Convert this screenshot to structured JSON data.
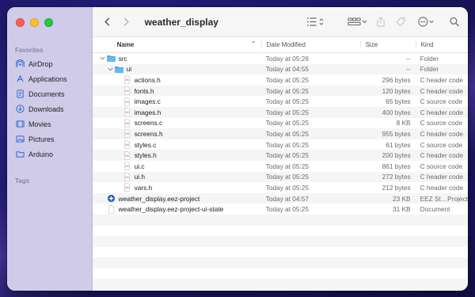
{
  "window": {
    "title": "weather_display"
  },
  "sidebar": {
    "favorites_label": "Favorites",
    "tags_label": "Tags",
    "items": [
      {
        "label": "AirDrop",
        "icon": "airdrop-icon"
      },
      {
        "label": "Applications",
        "icon": "applications-icon"
      },
      {
        "label": "Documents",
        "icon": "documents-icon"
      },
      {
        "label": "Downloads",
        "icon": "downloads-icon"
      },
      {
        "label": "Movies",
        "icon": "movies-icon"
      },
      {
        "label": "Pictures",
        "icon": "pictures-icon"
      },
      {
        "label": "Arduino",
        "icon": "folder-icon"
      }
    ]
  },
  "columns": {
    "name": "Name",
    "date": "Date Modified",
    "size": "Size",
    "kind": "Kind"
  },
  "rows": [
    {
      "name": "src",
      "date": "Today at 05:26",
      "size": "--",
      "kind": "Folder",
      "type": "folder",
      "level": 0,
      "expanded": true
    },
    {
      "name": "ui",
      "date": "Today at 04:55",
      "size": "--",
      "kind": "Folder",
      "type": "folder",
      "level": 1,
      "expanded": true
    },
    {
      "name": "actions.h",
      "date": "Today at 05:25",
      "size": "296 bytes",
      "kind": "C header code",
      "type": "file",
      "level": 2
    },
    {
      "name": "fonts.h",
      "date": "Today at 05:25",
      "size": "120 bytes",
      "kind": "C header code",
      "type": "file",
      "level": 2
    },
    {
      "name": "images.c",
      "date": "Today at 05:25",
      "size": "65 bytes",
      "kind": "C source code",
      "type": "file",
      "level": 2
    },
    {
      "name": "images.h",
      "date": "Today at 05:25",
      "size": "400 bytes",
      "kind": "C header code",
      "type": "file",
      "level": 2
    },
    {
      "name": "screens.c",
      "date": "Today at 05:25",
      "size": "8 KB",
      "kind": "C source code",
      "type": "file",
      "level": 2
    },
    {
      "name": "screens.h",
      "date": "Today at 05:25",
      "size": "955 bytes",
      "kind": "C header code",
      "type": "file",
      "level": 2
    },
    {
      "name": "styles.c",
      "date": "Today at 05:25",
      "size": "61 bytes",
      "kind": "C source code",
      "type": "file",
      "level": 2
    },
    {
      "name": "styles.h",
      "date": "Today at 05:25",
      "size": "200 bytes",
      "kind": "C header code",
      "type": "file",
      "level": 2
    },
    {
      "name": "ui.c",
      "date": "Today at 05:25",
      "size": "861 bytes",
      "kind": "C source code",
      "type": "file",
      "level": 2
    },
    {
      "name": "ui.h",
      "date": "Today at 05:25",
      "size": "272 bytes",
      "kind": "C header code",
      "type": "file",
      "level": 2
    },
    {
      "name": "vars.h",
      "date": "Today at 05:25",
      "size": "212 bytes",
      "kind": "C header code",
      "type": "file",
      "level": 2
    },
    {
      "name": "weather_display.eez-project",
      "date": "Today at 04:57",
      "size": "23 KB",
      "kind": "EEZ St…Project",
      "type": "eez",
      "level": 0
    },
    {
      "name": "weather_display.eez-project-ui-state",
      "date": "Today at 05:25",
      "size": "31 KB",
      "kind": "Document",
      "type": "doc",
      "level": 0
    },
    {
      "name": "",
      "date": "",
      "size": "",
      "kind": "",
      "type": "empty",
      "level": 0
    },
    {
      "name": "",
      "date": "",
      "size": "",
      "kind": "",
      "type": "empty",
      "level": 0
    },
    {
      "name": "",
      "date": "",
      "size": "",
      "kind": "",
      "type": "empty",
      "level": 0
    },
    {
      "name": "",
      "date": "",
      "size": "",
      "kind": "",
      "type": "empty",
      "level": 0
    },
    {
      "name": "",
      "date": "",
      "size": "",
      "kind": "",
      "type": "empty",
      "level": 0
    },
    {
      "name": "",
      "date": "",
      "size": "",
      "kind": "",
      "type": "empty",
      "level": 0
    },
    {
      "name": "",
      "date": "",
      "size": "",
      "kind": "",
      "type": "empty",
      "level": 0
    },
    {
      "name": "",
      "date": "",
      "size": "",
      "kind": "",
      "type": "empty",
      "level": 0
    }
  ]
}
